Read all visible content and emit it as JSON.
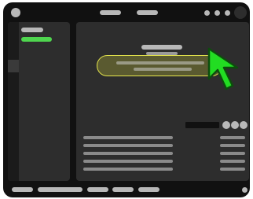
{
  "titlebar": {
    "window_dot_icon": "circle-icon",
    "tabs": [
      "",
      ""
    ],
    "window_controls": [
      "circle-icon",
      "circle-icon",
      "circle-icon"
    ],
    "avatar_icon": "avatar-icon"
  },
  "sidebar": {
    "items": [
      {
        "label": "",
        "state": "default"
      },
      {
        "label": "",
        "state": "active"
      }
    ],
    "active_color": "#4fd64f"
  },
  "main": {
    "heading": "",
    "subheading": "",
    "highlighted_field": {
      "lines": [
        "",
        ""
      ],
      "border_color": "#e6e64d",
      "fill_color": "#5a5a30"
    },
    "stat": {
      "label": "",
      "indicators": [
        "circle-icon",
        "circle-icon",
        "circle-icon"
      ]
    },
    "rows": [
      {
        "label": "",
        "value": ""
      },
      {
        "label": "",
        "value": ""
      },
      {
        "label": "",
        "value": ""
      },
      {
        "label": "",
        "value": ""
      },
      {
        "label": "",
        "value": ""
      }
    ]
  },
  "footer": {
    "items": [
      "",
      "",
      "",
      "",
      ""
    ],
    "status_icon": "circle-icon"
  },
  "cursor": {
    "icon": "arrow-pointer-icon",
    "color": "#22dd22"
  }
}
